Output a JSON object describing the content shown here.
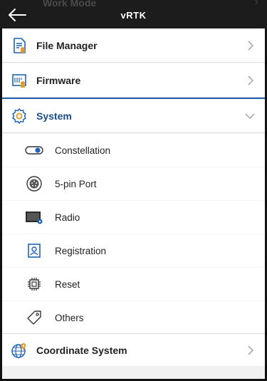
{
  "header": {
    "title": "vRTK",
    "ghost_text": "Work Mode"
  },
  "menu": {
    "file_manager": {
      "label": "File Manager"
    },
    "firmware": {
      "label": "Firmware"
    },
    "system": {
      "label": "System",
      "expanded": true,
      "items": [
        {
          "label": "Constellation"
        },
        {
          "label": "5-pin Port"
        },
        {
          "label": "Radio"
        },
        {
          "label": "Registration"
        },
        {
          "label": "Reset"
        },
        {
          "label": "Others"
        }
      ]
    },
    "coordinate_system": {
      "label": "Coordinate System"
    }
  },
  "colors": {
    "topbar": "#1c1c1c",
    "accent": "#1e63b4",
    "system_label": "#1a4d8c",
    "icon_orange": "#e39a2c"
  }
}
